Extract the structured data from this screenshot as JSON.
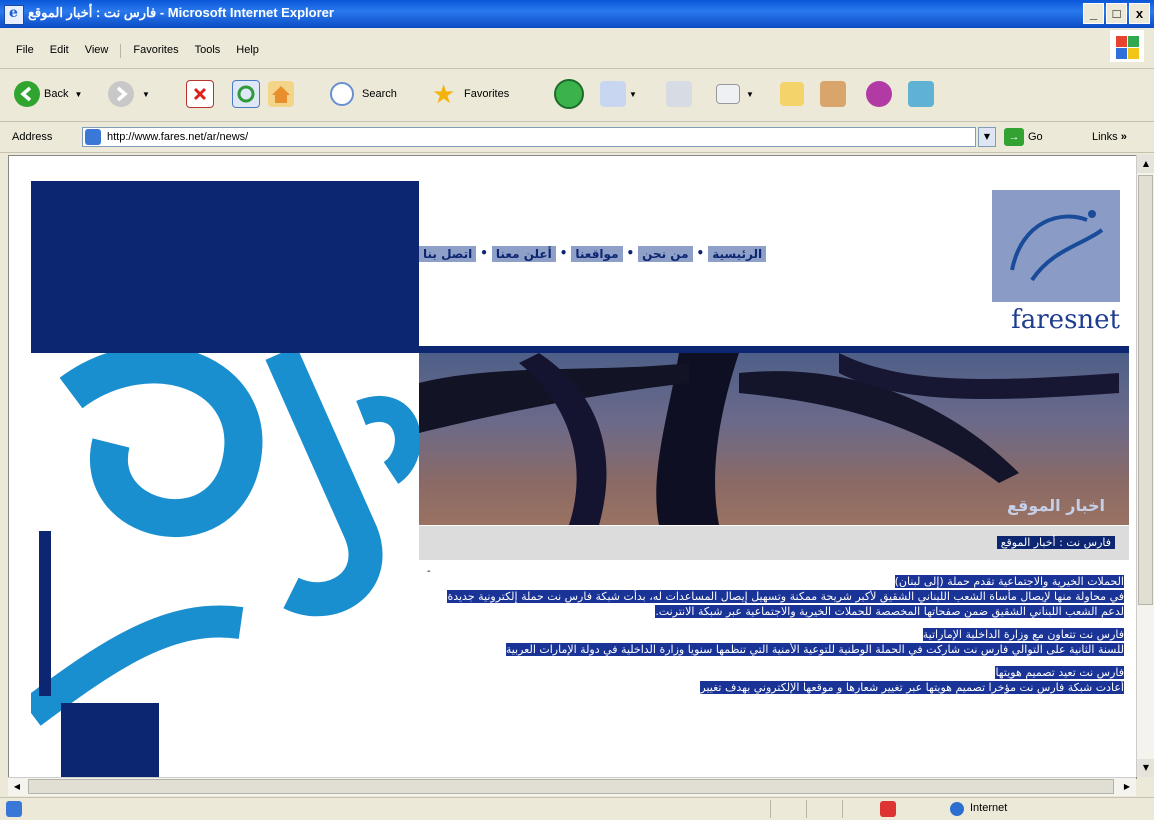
{
  "window": {
    "title": "فارس نت : أخبار الموقع - Microsoft Internet Explorer",
    "controls": [
      "_",
      "□",
      "x"
    ]
  },
  "menu": [
    "File",
    "Edit",
    "View",
    "Favorites",
    "Tools",
    "Help"
  ],
  "toolbar": {
    "back_label": "Back",
    "search_label": "Search",
    "favorites_label": "Favorites"
  },
  "address": {
    "label": "Address",
    "url": "http://www.fares.net/ar/news/",
    "go_label": "Go",
    "links_label": "Links"
  },
  "page": {
    "nav": [
      "الرئيسية",
      "من نحن",
      "مواقعنا",
      "أعلن معنا",
      "اتصل بنا"
    ],
    "logo_text": "faresnet",
    "banner_title": "اخبار الموقع",
    "breadcrumb": "فارس نت : أخبار الموقع",
    "news": [
      {
        "title": "الحملات الخيرية والاجتماعية تقدم حملة (إلى لبنان)",
        "body": "في محاولة منها لإيصال مأساة الشعب اللبناني الشقيق لأكبر شريحة ممكنة وتسهيل إيصال المساعدات له، بدأت شبكة فارس نت حملة إلكترونية جديدة لدعم الشعب اللبناني الشقيق ضمن صفحاتها المخصصة للحملات الخيرية والاجتماعية عبر شبكة الانترنت."
      },
      {
        "title": "فارس نت تتعاون مع وزارة الداخلية الإماراتية",
        "body": "للسنة الثانية على التوالي فارس نت شاركت في الحملة الوطنية للتوعية الأمنية التي تنظمها سنويا وزارة الداخلية في دولة الإمارات العربية"
      },
      {
        "title": "فارس نت تعيد تصميم هويتها",
        "body": "أعادت شبكة فارس نت مؤخرا تصميم هويتها عبر تغيير شعارها و موقعها الإلكتروني بهدف تغيير"
      }
    ]
  },
  "status": {
    "zone": "Internet"
  },
  "colors": {
    "navy": "#0d2672",
    "highlight": "#1a3396",
    "xp_blue": "#0a57d8",
    "calligraphy_blue": "#1a8fcf"
  }
}
